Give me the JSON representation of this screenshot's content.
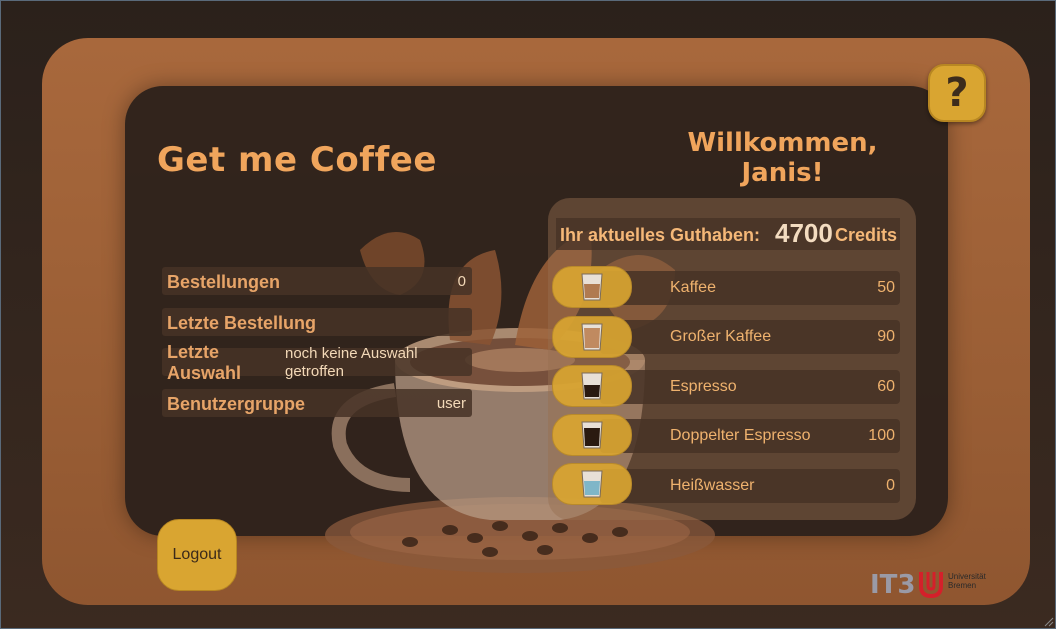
{
  "app": {
    "title": "Get me Coffee",
    "welcome": "Willkommen, Janis!"
  },
  "help": {
    "label": "?"
  },
  "info": [
    {
      "label": "Bestellungen",
      "value": "0"
    },
    {
      "label": "Letzte Bestellung",
      "value": ""
    },
    {
      "label": "Letzte Auswahl",
      "value": "noch keine Auswahl getroffen"
    },
    {
      "label": "Benutzergruppe",
      "value": "user"
    }
  ],
  "balance": {
    "prefix": "Ihr aktuelles Guthaben:",
    "amount": "4700",
    "unit": "Credits"
  },
  "beverages": [
    {
      "name": "Kaffee",
      "price": "50",
      "icon": "coffee-glass-icon"
    },
    {
      "name": "Großer Kaffee",
      "price": "90",
      "icon": "large-coffee-glass-icon"
    },
    {
      "name": "Espresso",
      "price": "60",
      "icon": "espresso-glass-icon"
    },
    {
      "name": "Doppelter Espresso",
      "price": "100",
      "icon": "double-espresso-glass-icon"
    },
    {
      "name": "Heißwasser",
      "price": "0",
      "icon": "hot-water-glass-icon"
    }
  ],
  "logout": {
    "label": "Logout"
  },
  "logo": {
    "it3": "IT3",
    "uni_line1": "Universität",
    "uni_line2": "Bremen"
  },
  "colors": {
    "accent": "#d9a531",
    "title": "#f0a55c",
    "frame": "#a8683c",
    "panel": "#2d211b"
  }
}
